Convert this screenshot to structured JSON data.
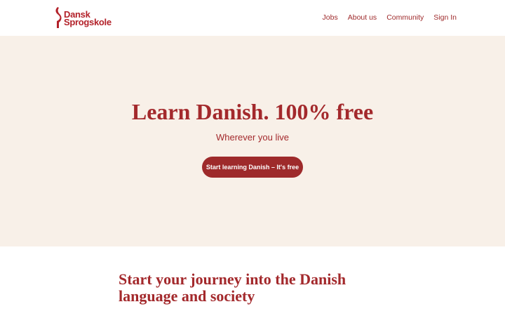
{
  "brand": {
    "name_line1": "Dansk",
    "name_line2": "Sprogskole",
    "icon": "logo-mark",
    "color": "#b3222a"
  },
  "nav": {
    "items": [
      {
        "label": "Jobs"
      },
      {
        "label": "About us"
      },
      {
        "label": "Community"
      },
      {
        "label": "Sign In"
      }
    ]
  },
  "hero": {
    "title": "Learn Danish. 100% free",
    "subtitle": "Wherever you live",
    "cta_label": "Start learning Danish – It's free",
    "background": "#f8f0e8",
    "accent": "#9e2a2b"
  },
  "section": {
    "title_line1": "Start your journey into the Danish",
    "title_line2": "language and society"
  }
}
